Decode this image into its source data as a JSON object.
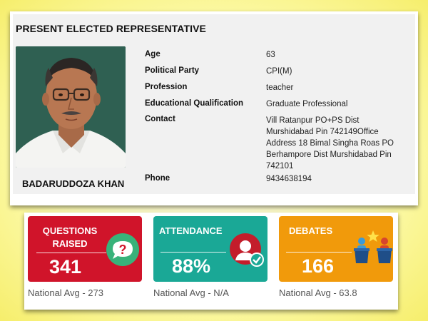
{
  "representative": {
    "section_title": "PRESENT ELECTED REPRESENTATIVE",
    "name": "BADARUDDOZA KHAN",
    "details": [
      {
        "label": "Age",
        "value": "63"
      },
      {
        "label": "Political Party",
        "value": "CPI(M)"
      },
      {
        "label": "Profession",
        "value": "teacher"
      },
      {
        "label": "Educational Qualification",
        "value": "Graduate Professional"
      },
      {
        "label": "Contact",
        "value": "Vill Ratanpur PO+PS Dist Murshidabad Pin 742149Office Address 18 Bimal Singha Roas PO Berhampore Dist Murshidabad Pin 742101"
      },
      {
        "label": "Phone",
        "value": "9434638194"
      }
    ]
  },
  "stats": [
    {
      "title": "QUESTIONS RAISED",
      "value": "341",
      "national_avg": "National Avg - 273",
      "color": "#d0142a",
      "icon": "question-bubble-icon"
    },
    {
      "title": "ATTENDANCE",
      "value": "88%",
      "national_avg": "National Avg - N/A",
      "color": "#1aa896",
      "icon": "user-check-icon"
    },
    {
      "title": "DEBATES",
      "value": "166",
      "national_avg": "National Avg - 63.8",
      "color": "#f19a0b",
      "icon": "debate-podium-icon"
    }
  ]
}
